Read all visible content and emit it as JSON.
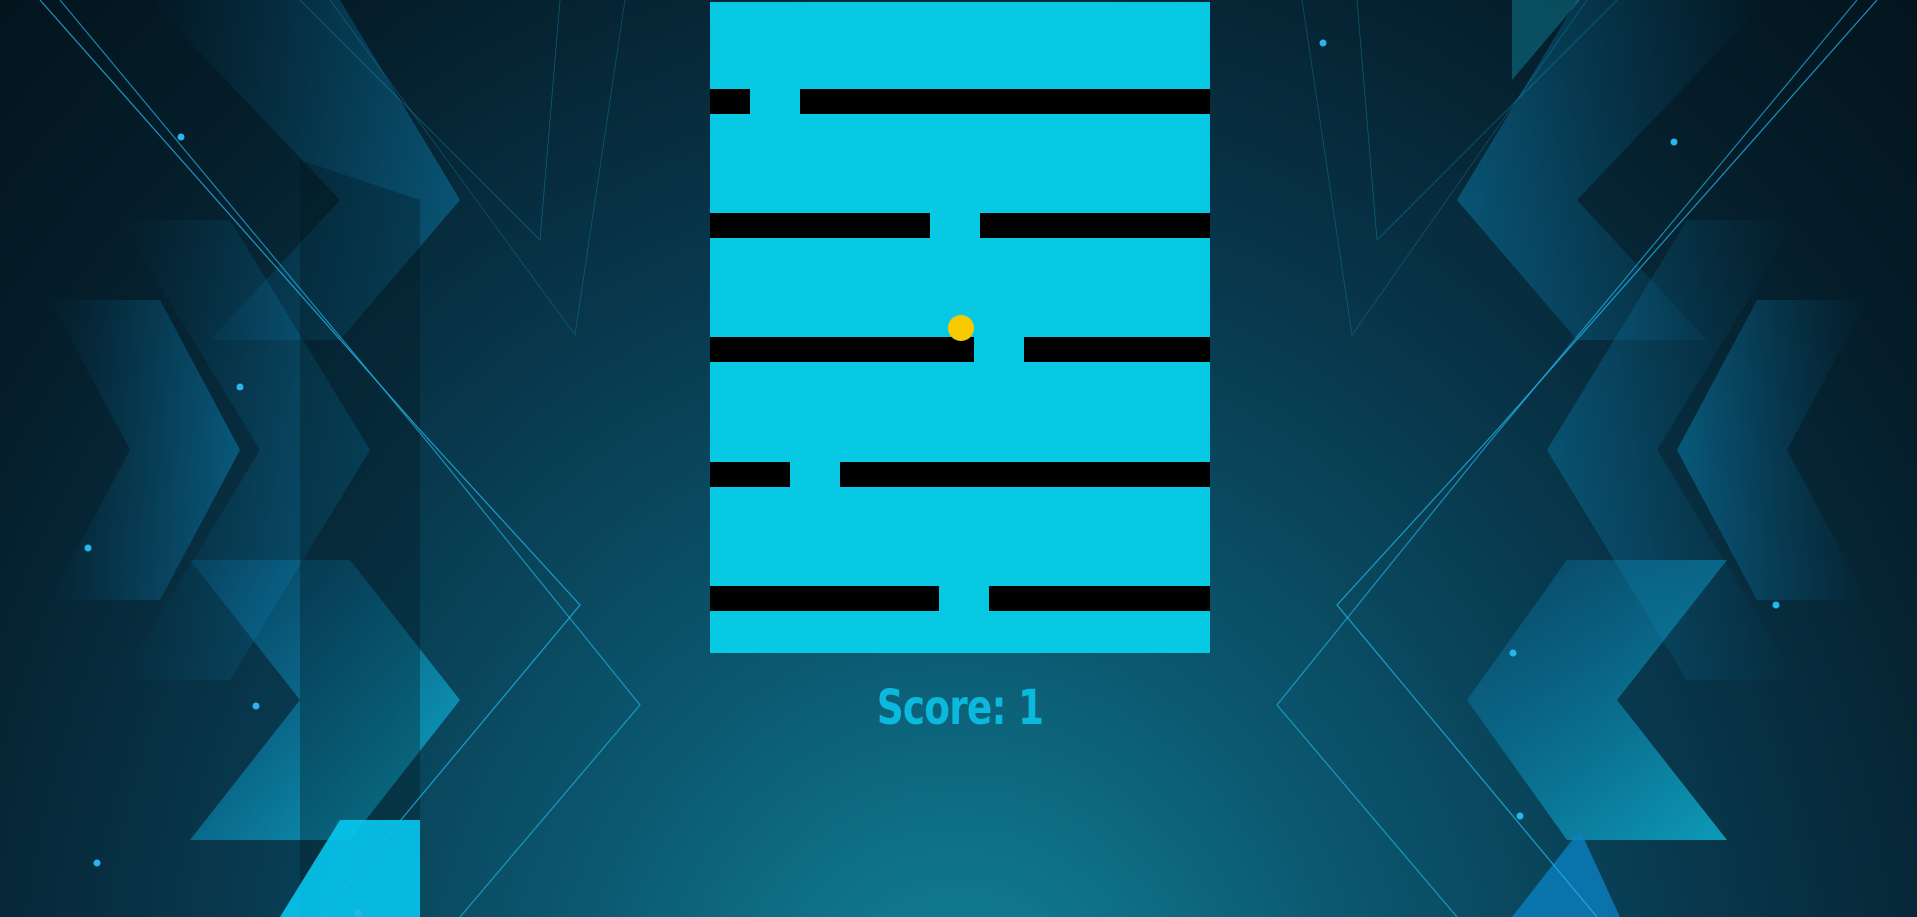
{
  "game": {
    "score_label": "Score:",
    "score_value": "1",
    "board_color": "#07c9e3",
    "platform_color": "#000000",
    "ball_color": "#f7cb00",
    "accent_color": "#0bb9de"
  },
  "platforms": [
    {
      "name": "platform-row-1"
    },
    {
      "name": "platform-row-2"
    },
    {
      "name": "platform-row-3"
    },
    {
      "name": "platform-row-4"
    },
    {
      "name": "platform-row-5"
    }
  ],
  "ball": {
    "icon": "ball-icon"
  }
}
